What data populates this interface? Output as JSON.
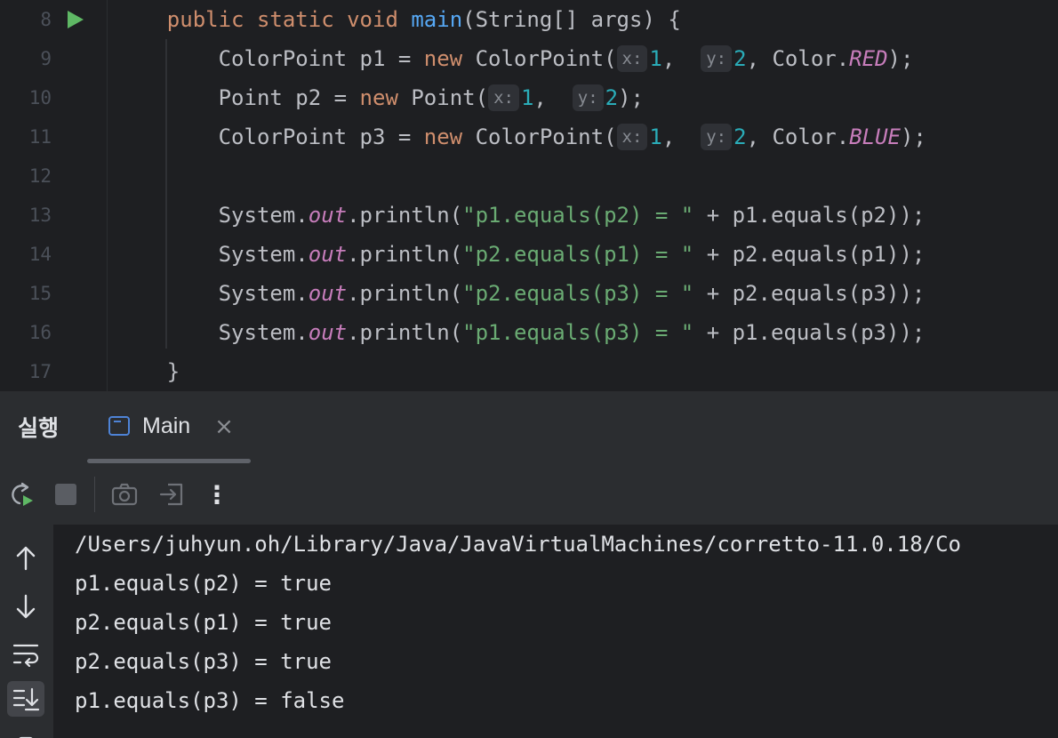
{
  "editor": {
    "lines": [
      {
        "num": "8",
        "segments": [
          {
            "t": "    ",
            "c": ""
          },
          {
            "t": "public",
            "c": "kw"
          },
          {
            "t": " ",
            "c": ""
          },
          {
            "t": "static",
            "c": "kw"
          },
          {
            "t": " ",
            "c": ""
          },
          {
            "t": "void",
            "c": "kw"
          },
          {
            "t": " ",
            "c": ""
          },
          {
            "t": "main",
            "c": "fn"
          },
          {
            "t": "(String[] args) {",
            "c": ""
          }
        ]
      },
      {
        "num": "9",
        "segments": [
          {
            "t": "        ColorPoint p1 = ",
            "c": ""
          },
          {
            "t": "new",
            "c": "kw"
          },
          {
            "t": " ColorPoint(",
            "c": ""
          },
          {
            "t": "x:",
            "c": "hint"
          },
          {
            "t": "1",
            "c": "num"
          },
          {
            "t": ",  ",
            "c": ""
          },
          {
            "t": "y:",
            "c": "hint"
          },
          {
            "t": "2",
            "c": "num"
          },
          {
            "t": ", Color.",
            "c": ""
          },
          {
            "t": "RED",
            "c": "it"
          },
          {
            "t": ");",
            "c": ""
          }
        ]
      },
      {
        "num": "10",
        "segments": [
          {
            "t": "        Point p2 = ",
            "c": ""
          },
          {
            "t": "new",
            "c": "kw"
          },
          {
            "t": " Point(",
            "c": ""
          },
          {
            "t": "x:",
            "c": "hint"
          },
          {
            "t": "1",
            "c": "num"
          },
          {
            "t": ",  ",
            "c": ""
          },
          {
            "t": "y:",
            "c": "hint"
          },
          {
            "t": "2",
            "c": "num"
          },
          {
            "t": ");",
            "c": ""
          }
        ]
      },
      {
        "num": "11",
        "segments": [
          {
            "t": "        ColorPoint p3 = ",
            "c": ""
          },
          {
            "t": "new",
            "c": "kw"
          },
          {
            "t": " ColorPoint(",
            "c": ""
          },
          {
            "t": "x:",
            "c": "hint"
          },
          {
            "t": "1",
            "c": "num"
          },
          {
            "t": ",  ",
            "c": ""
          },
          {
            "t": "y:",
            "c": "hint"
          },
          {
            "t": "2",
            "c": "num"
          },
          {
            "t": ", Color.",
            "c": ""
          },
          {
            "t": "BLUE",
            "c": "it"
          },
          {
            "t": ");",
            "c": ""
          }
        ]
      },
      {
        "num": "12",
        "segments": []
      },
      {
        "num": "13",
        "segments": [
          {
            "t": "        System.",
            "c": ""
          },
          {
            "t": "out",
            "c": "it"
          },
          {
            "t": ".println(",
            "c": ""
          },
          {
            "t": "\"p1.equals(p2) = \"",
            "c": "str"
          },
          {
            "t": " + p1.equals(p2));",
            "c": ""
          }
        ]
      },
      {
        "num": "14",
        "segments": [
          {
            "t": "        System.",
            "c": ""
          },
          {
            "t": "out",
            "c": "it"
          },
          {
            "t": ".println(",
            "c": ""
          },
          {
            "t": "\"p2.equals(p1) = \"",
            "c": "str"
          },
          {
            "t": " + p2.equals(p1));",
            "c": ""
          }
        ]
      },
      {
        "num": "15",
        "segments": [
          {
            "t": "        System.",
            "c": ""
          },
          {
            "t": "out",
            "c": "it"
          },
          {
            "t": ".println(",
            "c": ""
          },
          {
            "t": "\"p2.equals(p3) = \"",
            "c": "str"
          },
          {
            "t": " + p2.equals(p3));",
            "c": ""
          }
        ]
      },
      {
        "num": "16",
        "segments": [
          {
            "t": "        System.",
            "c": ""
          },
          {
            "t": "out",
            "c": "it"
          },
          {
            "t": ".println(",
            "c": ""
          },
          {
            "t": "\"p1.equals(p3) = \"",
            "c": "str"
          },
          {
            "t": " + p1.equals(p3));",
            "c": ""
          }
        ]
      },
      {
        "num": "17",
        "segments": [
          {
            "t": "    }",
            "c": ""
          }
        ]
      }
    ]
  },
  "run_panel": {
    "title": "실행",
    "tab_label": "Main",
    "tab_close": "×",
    "more_glyph": "⋮"
  },
  "console": {
    "lines": [
      "/Users/juhyun.oh/Library/Java/JavaVirtualMachines/corretto-11.0.18/Co",
      "p1.equals(p2) = true",
      "p2.equals(p1) = true",
      "p2.equals(p3) = true",
      "p1.equals(p3) = false"
    ]
  },
  "colors": {
    "background": "#1e1f22",
    "panel": "#2b2d30",
    "keyword": "#cf8e6d",
    "function": "#56a8f5",
    "number": "#2aacb8",
    "string": "#6aab73",
    "static_field": "#c77dbb",
    "run_green": "#5fb865",
    "tab_icon_blue": "#4e83d6"
  }
}
